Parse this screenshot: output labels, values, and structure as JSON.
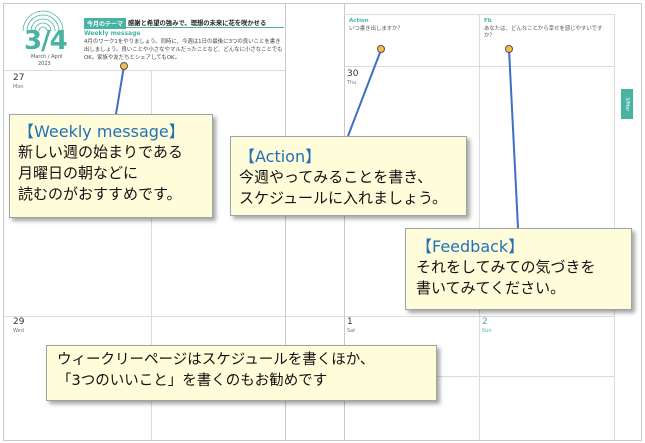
{
  "planner": {
    "date_big": "3/4",
    "month": "March / April",
    "year": "2023",
    "theme_tag": "今月のテーマ",
    "theme_text": "感謝と希望の強みで、理想の未来に花を咲かせる",
    "weekly_message_label": "Weekly message",
    "weekly_message_body": "4月のワーク1をやりましょう。同時に、今週は1日の最後に3つの良いことを書き出しましょう。良いことや小さなやマルだったことなど、どんなに小さなことでもOK。家族や友だちとシェアしてもOK。",
    "action_label": "Action",
    "action_note": "いつ書き出しますか？",
    "fb_label": "Fb",
    "fb_note": "あなたは、どんなことから幸せを感じやすいですか？",
    "side_tab": "3/Mar",
    "days": [
      {
        "num": "27",
        "name": "Mon"
      },
      {
        "num": "30",
        "name": "Thu"
      },
      {
        "num": "29",
        "name": "Wed"
      },
      {
        "num": "1",
        "name": "Sat"
      },
      {
        "num": "2",
        "name": "Sun"
      }
    ]
  },
  "callouts": {
    "weekly": {
      "title": "【Weekly message】",
      "lines": [
        "新しい週の始まりである",
        "月曜日の朝などに",
        "読むのがおすすめです。"
      ]
    },
    "action": {
      "title": "【Action】",
      "lines": [
        "今週やってみることを書き、",
        "スケジュールに入れましょう。"
      ]
    },
    "feedback": {
      "title": "【Feedback】",
      "lines": [
        "それをしてみての気づきを",
        "書いてみてください。"
      ]
    },
    "bottom": {
      "lines": [
        "ウィークリーページはスケジュールを書くほか、",
        "「3つのいいこと」を書くのもお勧めです"
      ]
    }
  },
  "colors": {
    "accent": "#46b3a3",
    "callout_bg": "#fffcd9",
    "title_blue": "#1f72b8",
    "sunday": "#46b3a3"
  }
}
